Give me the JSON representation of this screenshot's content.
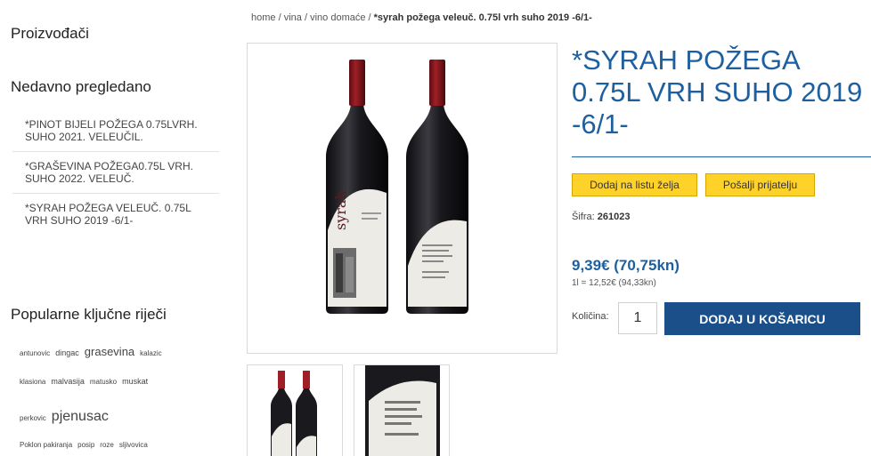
{
  "sidebar": {
    "producers_heading": "Proizvođači",
    "recent_heading": "Nedavno pregledano",
    "recent_items": [
      "*PINOT BIJELI POŽEGA 0.75LVRH. SUHO 2021. VELEUČIL.",
      "*GRAŠEVINA POŽEGA0.75L VRH. SUHO 2022. VELEUČ.",
      "*SYRAH POŽEGA VELEUČ. 0.75L VRH SUHO 2019 -6/1-"
    ],
    "tags_heading": "Popularne ključne riječi",
    "tags": {
      "antunovic": "antunovic",
      "dingac": "dingac",
      "grasevina": "grasevina",
      "kalazic": "kalazic",
      "klasiona": "klasiona",
      "malvasija": "malvasija",
      "matusko": "matusko",
      "muskat": "muskat",
      "perkovic": "perkovic",
      "pjenusac": "pjenusac",
      "poklon": "Poklon pakiranja",
      "posip": "posip",
      "roze": "roze",
      "sljivovica": "sljivovica"
    }
  },
  "breadcrumb": {
    "home": "home",
    "sep": "/",
    "vina": "vina",
    "vino_domace": "vino domaće",
    "current": "*syrah požega veleuč. 0.75l vrh suho 2019 -6/1-"
  },
  "product": {
    "title": "*SYRAH POŽEGA 0.75L VRH SUHO 2019 -6/1-",
    "wishlist_label": "Dodaj na listu želja",
    "send_label": "Pošalji prijatelju",
    "sku_label": "Šifra:",
    "sku_value": "261023",
    "price": "9,39€ (70,75kn)",
    "unit_price": "1l = 12,52€ (94,33kn)",
    "qty_label": "Količina:",
    "qty_value": "1",
    "add_to_cart": "DODAJ U KOŠARICU",
    "label_text": "syrah"
  },
  "colors": {
    "brand_blue": "#1e5fa0",
    "cart_button": "#1a4f8a",
    "yellow_button": "#ffd22a"
  }
}
